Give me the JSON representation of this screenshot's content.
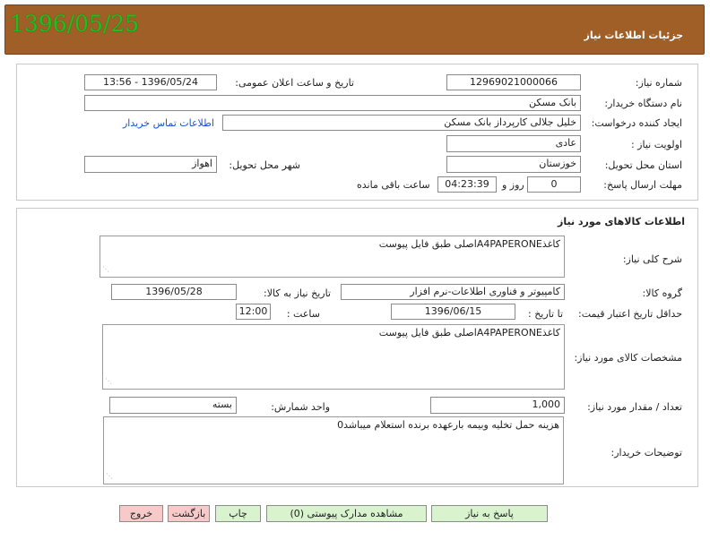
{
  "header": {
    "title": "جزئیات اطلاعات نیاز",
    "date_stamp": "1396/05/25"
  },
  "need_info": {
    "need_number_label": "شماره نیاز:",
    "need_number": "12969021000066",
    "announce_label": "تاریخ و ساعت اعلان عمومی:",
    "announce_value": "1396/05/24 - 13:56",
    "buyer_label": "نام دستگاه خریدار:",
    "buyer_value": "بانک مسکن",
    "requester_label": "ایجاد کننده درخواست:",
    "requester_value": "خلیل جلالی کارپرداز بانک مسکن",
    "contact_link": "اطلاعات تماس خریدار",
    "priority_label": "اولویت نیاز :",
    "priority_value": "عادی",
    "province_label": "استان محل تحویل:",
    "province_value": "خوزستان",
    "city_label": "شهر محل تحویل:",
    "city_value": "اهواز",
    "deadline_label": "مهلت ارسال پاسخ:",
    "days_value": "0",
    "days_word": "روز و",
    "time_remaining": "04:23:39",
    "remaining_label": "ساعت باقی مانده"
  },
  "goods": {
    "section_title": "اطلاعات کالاهای مورد نیاز",
    "desc_label": "شرح کلی نیاز:",
    "desc_value": "کاغذA4PAPERONEاصلی طبق فایل پیوست",
    "group_label": "گروه کالا:",
    "group_value": "کامپیوتر و فناوری اطلاعات-نرم افزار",
    "need_date_label": "تاریخ نیاز به کالا:",
    "need_date_value": "1396/05/28",
    "validity_label": "حداقل تاریخ اعتبار قیمت:",
    "until_date_label": "تا تاریخ :",
    "until_date_value": "1396/06/15",
    "hour_label": "ساعت :",
    "hour_value": "12:00",
    "spec_label": "مشخصات کالای مورد نیاز:",
    "spec_value": "کاغذA4PAPERONEاصلی طبق فایل پیوست",
    "qty_label": "تعداد / مقدار مورد نیاز:",
    "qty_value": "1,000",
    "unit_label": "واحد شمارش:",
    "unit_value": "بسته",
    "notes_label": "توضیحات خریدار:",
    "notes_value": "هزینه حمل تخلیه وبیمه بارعهده برنده استعلام میباشد0"
  },
  "buttons": {
    "reply": "پاسخ به نیاز",
    "view_docs": "مشاهده مدارک پیوستی (0)",
    "print": "چاپ",
    "back": "بازگشت",
    "exit": "خروج"
  },
  "colors": {
    "header_bg": "#a05f27",
    "date_stamp": "#1fbf1f",
    "link": "#1a53c9",
    "btn_green": "#d8f3ce",
    "btn_pink": "#f7c9c9"
  }
}
